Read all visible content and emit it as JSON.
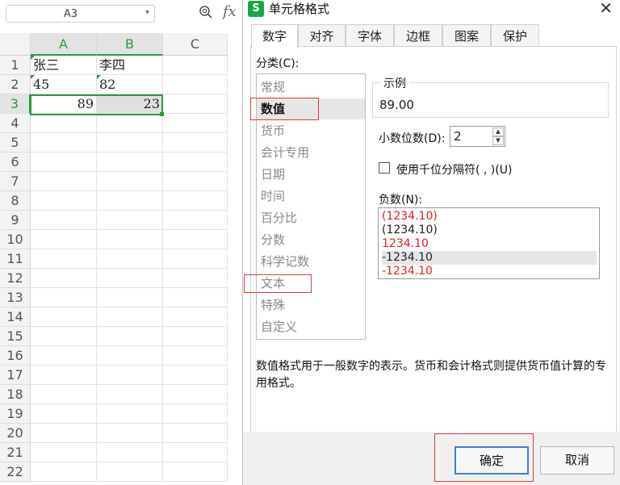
{
  "spreadsheet": {
    "name_box": "A3",
    "fx_label": "fx",
    "columns": [
      "A",
      "B",
      "C"
    ],
    "rows": [
      "1",
      "2",
      "3",
      "4",
      "5",
      "6",
      "7",
      "8",
      "9",
      "10",
      "11",
      "12",
      "13",
      "14",
      "15",
      "16",
      "17",
      "18",
      "19",
      "20",
      "21",
      "22"
    ],
    "cells": {
      "A1": "张三",
      "B1": "李四",
      "A2": "45",
      "B2": "82",
      "A3": "89",
      "B3": "23"
    }
  },
  "dialog": {
    "title": "单元格格式",
    "tabs": [
      "数字",
      "对齐",
      "字体",
      "边框",
      "图案",
      "保护"
    ],
    "category_label": "分类(C):",
    "categories": [
      "常规",
      "数值",
      "货币",
      "会计专用",
      "日期",
      "时间",
      "百分比",
      "分数",
      "科学记数",
      "文本",
      "特殊",
      "自定义"
    ],
    "selected_category": "数值",
    "sample_label": "示例",
    "sample_value": "89.00",
    "decimal_label": "小数位数(D):",
    "decimal_value": "2",
    "thousands_label": "使用千位分隔符( , )(U)",
    "thousands_checked": false,
    "negative_label": "负数(N):",
    "negative_options": [
      "(1234.10)",
      "(1234.10)",
      "1234.10",
      "-1234.10",
      "-1234.10"
    ],
    "negative_selected_index": 3,
    "description": "数值格式用于一般数字的表示。货币和会计格式则提供货币值计算的专用格式。",
    "ok_label": "确定",
    "cancel_label": "取消"
  },
  "colors": {
    "accent_green": "#2b9a3b",
    "negative_red": "#e02020",
    "highlight_red_box": "#e03a3a",
    "primary_button_border": "#3a7fd5"
  }
}
